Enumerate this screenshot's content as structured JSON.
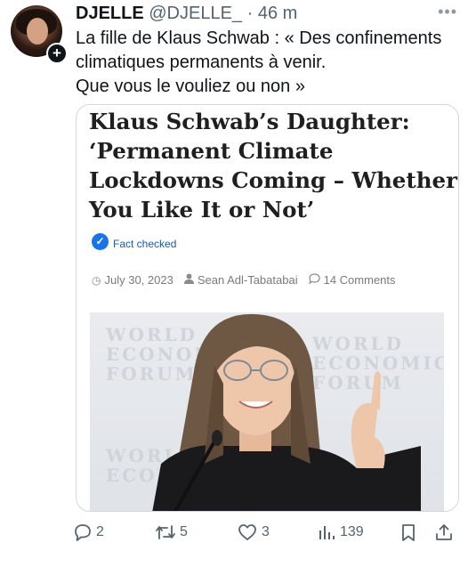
{
  "tweet": {
    "display_name": "DJELLE",
    "handle": "@DJELLE_",
    "separator": "·",
    "time": "46 m",
    "text_lines": [
      "La fille de Klaus Schwab : « Des confinements",
      "climatiques permanents à venir.",
      "Que vous le vouliez ou non »"
    ]
  },
  "card": {
    "headline_lines": [
      "Klaus Schwab’s Daughter:",
      "‘Permanent Climate",
      "Lockdowns Coming – Whether",
      "You Like It or Not’"
    ],
    "fact_checked": "Fact checked",
    "date": "July 30, 2023",
    "author": "Sean Adl-Tabatabai",
    "comments": "14 Comments",
    "watermark_lines": [
      "WORLD",
      "ECONOMIC",
      "FORUM"
    ]
  },
  "actions": {
    "replies": "2",
    "reposts": "5",
    "likes": "3",
    "views": "139"
  },
  "icons": {
    "reply": "reply-icon",
    "repost": "repost-icon",
    "like": "heart-icon",
    "views": "views-icon",
    "bookmark": "bookmark-icon",
    "share": "share-icon"
  },
  "colors": {
    "text": "#0f1419",
    "muted": "#536471",
    "border": "#cfd9de",
    "fact_check_blue": "#1a73e8"
  }
}
